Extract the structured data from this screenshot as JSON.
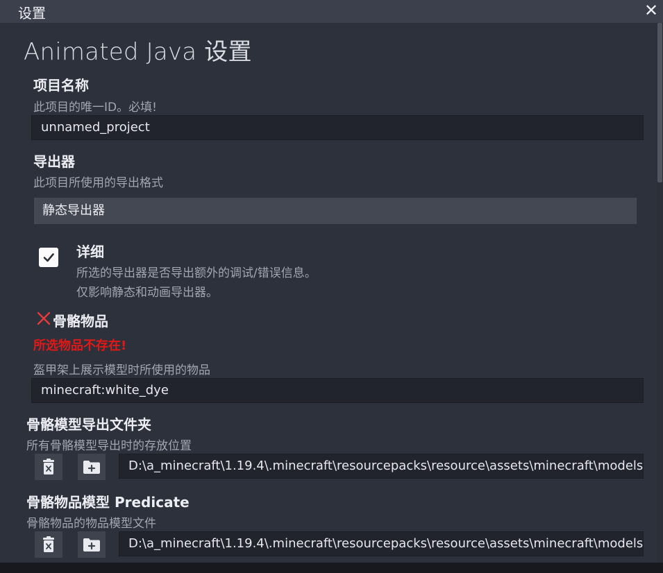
{
  "window": {
    "title": "设置",
    "close_label": "✕"
  },
  "page": {
    "heading": "Animated Java 设置"
  },
  "fields": {
    "project_name": {
      "label": "项目名称",
      "desc": "此项目的唯一ID。必填!",
      "value": "unnamed_project"
    },
    "exporter": {
      "label": "导出器",
      "desc": "此项目所使用的导出格式",
      "selected": "静态导出器"
    },
    "verbose": {
      "label": "详细",
      "desc_line1": "所选的导出器是否导出额外的调试/错误信息。",
      "desc_line2": "仅影响静态和动画导出器。",
      "checked": true
    },
    "rig_item": {
      "label": "骨骼物品",
      "error_icon": "error-x-icon",
      "error": "所选物品不存在!",
      "desc": "盔甲架上展示模型时所使用的物品",
      "value": "minecraft:white_dye"
    },
    "rig_export_folder": {
      "label": "骨骼模型导出文件夹",
      "desc": "所有骨骼模型导出时的存放位置",
      "value": "D:\\a_minecraft\\1.19.4\\.minecraft\\resourcepacks\\resource\\assets\\minecraft\\models\\class",
      "clear_icon": "clear-icon",
      "browse_icon": "folder-plus-icon"
    },
    "rig_predicate": {
      "label": "骨骼物品模型 Predicate",
      "desc": "骨骼物品的物品模型文件",
      "value": "D:\\a_minecraft\\1.19.4\\.minecraft\\resourcepacks\\resource\\assets\\minecraft\\models\\class",
      "clear_icon": "clear-icon",
      "browse_icon": "folder-plus-icon"
    }
  },
  "colors": {
    "titlebar": "#3c404c",
    "panel": "#2d313b",
    "input": "#21242c",
    "select": "#444853",
    "error": "#e01818"
  }
}
